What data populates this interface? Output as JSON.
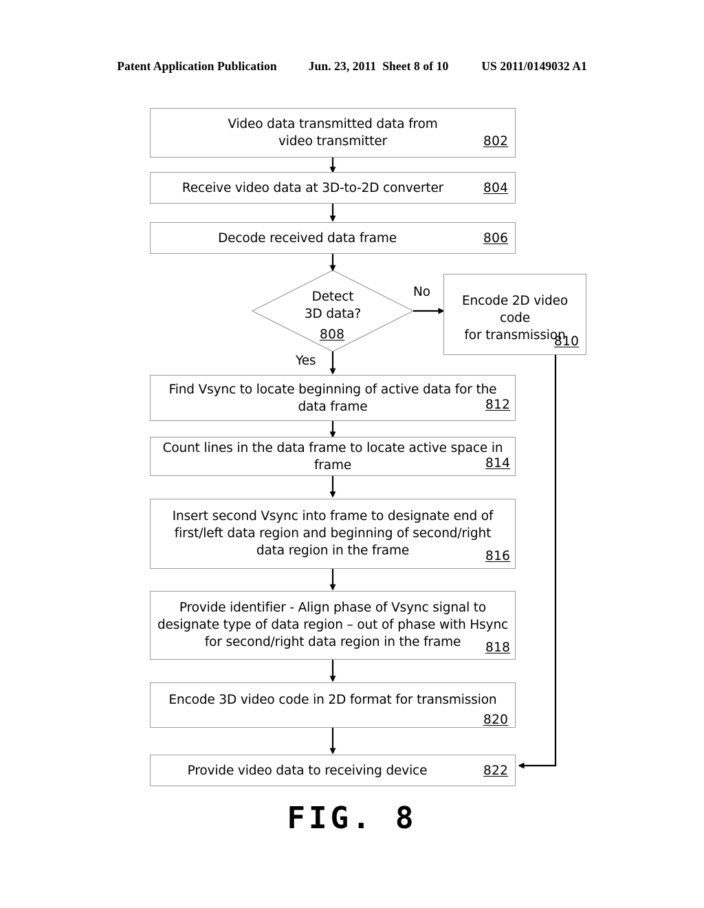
{
  "header": {
    "publication": "Patent Application Publication",
    "date": "Jun. 23, 2011",
    "sheet": "Sheet 8 of 10",
    "patent_number": "US 2011/0149032 A1"
  },
  "figure": {
    "caption": "FIG. 8"
  },
  "flowchart": {
    "nodes": [
      {
        "id": "802",
        "type": "process",
        "text": "Video data transmitted data from\nvideo transmitter",
        "ref": "802"
      },
      {
        "id": "804",
        "type": "process",
        "text": "Receive video data at 3D-to-2D converter",
        "ref": "804"
      },
      {
        "id": "806",
        "type": "process",
        "text": "Decode received data frame",
        "ref": "806"
      },
      {
        "id": "808",
        "type": "decision",
        "text": "Detect\n3D data?",
        "ref": "808"
      },
      {
        "id": "810",
        "type": "process",
        "text": "Encode 2D video code\nfor transmission",
        "ref": "810"
      },
      {
        "id": "812",
        "type": "process",
        "text": "Find Vsync to locate beginning of active data for the\ndata frame",
        "ref": "812"
      },
      {
        "id": "814",
        "type": "process",
        "text": "Count lines in the data frame to locate active space in\nframe",
        "ref": "814"
      },
      {
        "id": "816",
        "type": "process",
        "text": "Insert second Vsync into frame to designate end of\nfirst/left data region and beginning of second/right\ndata region in the frame",
        "ref": "816"
      },
      {
        "id": "818",
        "type": "process",
        "text": "Provide identifier - Align phase of Vsync signal to\ndesignate type of data region – out of phase with Hsync\nfor second/right data region in the frame",
        "ref": "818"
      },
      {
        "id": "820",
        "type": "process",
        "text": "Encode 3D video code in 2D format for transmission",
        "ref": "820"
      },
      {
        "id": "822",
        "type": "process",
        "text": "Provide video data to receiving device",
        "ref": "822"
      }
    ],
    "branch_labels": {
      "no": "No",
      "yes": "Yes"
    }
  },
  "colors": {
    "stroke": "#9a9a9a",
    "connector": "#000000",
    "text": "#000000",
    "background": "#ffffff"
  }
}
